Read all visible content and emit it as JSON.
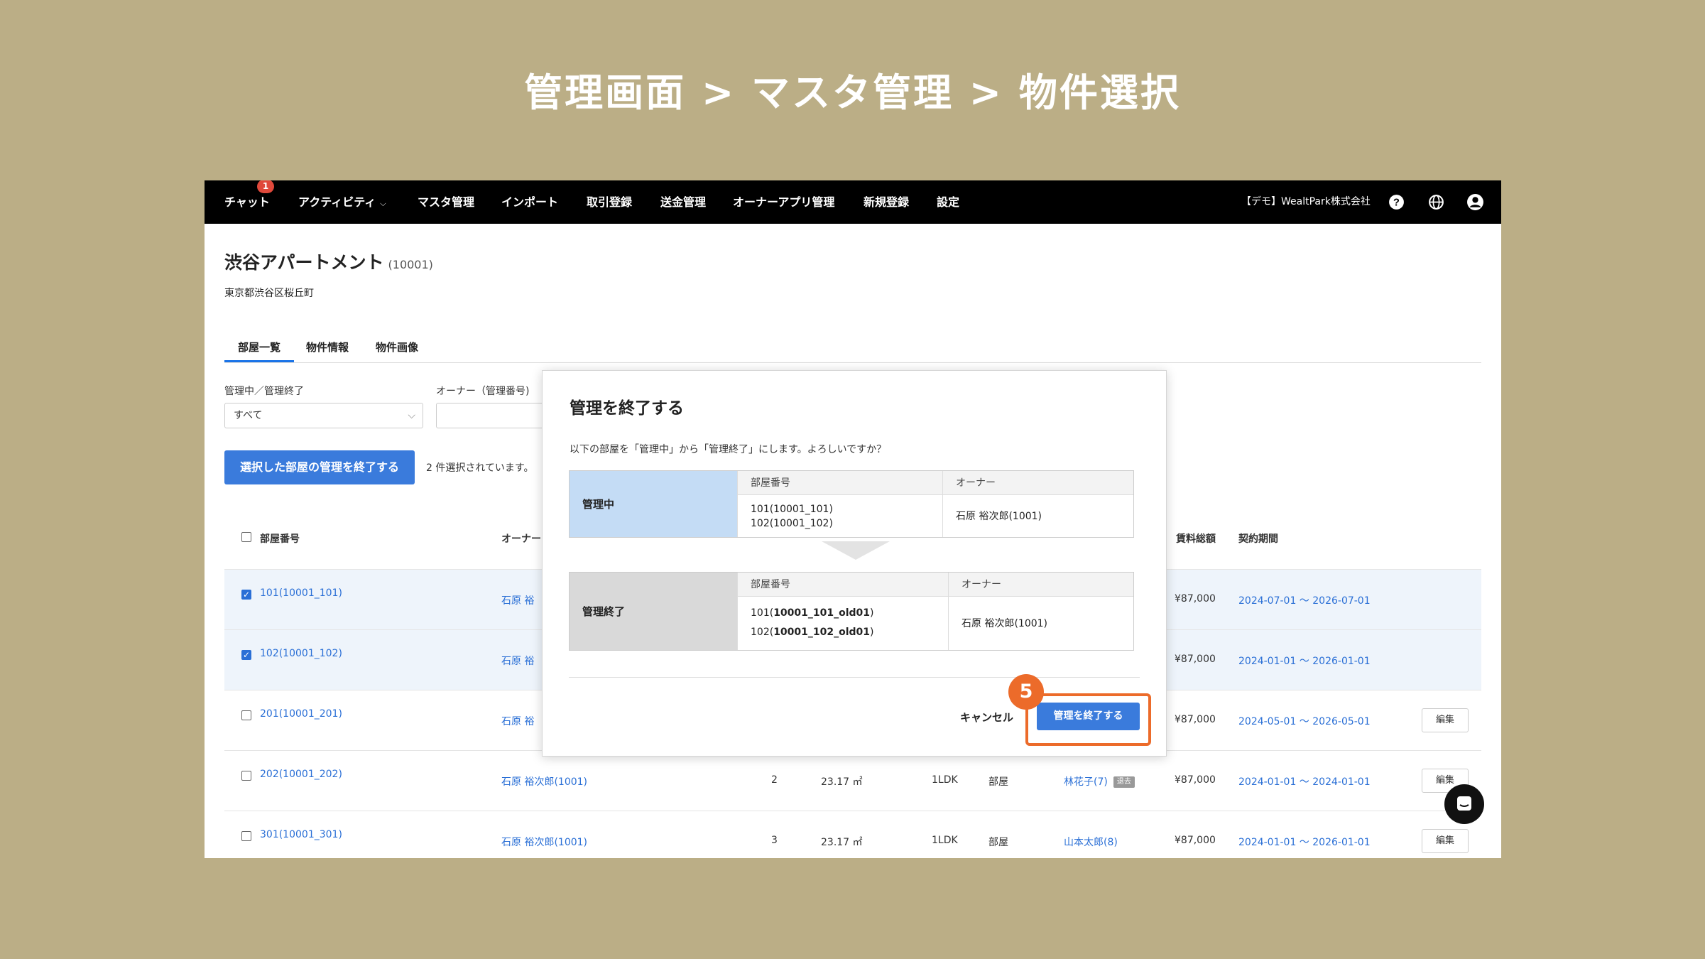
{
  "slide_title": "管理画面 > マスタ管理 > 物件選択",
  "nav": {
    "items": [
      {
        "label": "チャット",
        "badge": "1"
      },
      {
        "label": "アクティビティ"
      },
      {
        "label": "マスタ管理"
      },
      {
        "label": "インポート"
      },
      {
        "label": "取引登録"
      },
      {
        "label": "送金管理"
      },
      {
        "label": "オーナーアプリ管理"
      },
      {
        "label": "新規登録"
      },
      {
        "label": "設定"
      }
    ],
    "company": "【デモ】WealtPark株式会社",
    "icons": [
      "help-icon",
      "globe-icon",
      "user-account-icon"
    ]
  },
  "property": {
    "name": "渋谷アパートメント",
    "code": "(10001)",
    "address": "東京都渋谷区桜丘町"
  },
  "tabs": [
    "部屋一覧",
    "物件情報",
    "物件画像"
  ],
  "filters": {
    "status_label": "管理中／管理終了",
    "status_value": "すべて",
    "owner_label": "オーナー（管理番号)"
  },
  "bulk": {
    "end_button": "選択した部屋の管理を終了する",
    "selected_text": "2 件選択されています。"
  },
  "table": {
    "headers": {
      "room": "部屋番号",
      "owner": "オーナー",
      "rent_total": "賃料総額",
      "contract": "契約期間"
    },
    "rows": [
      {
        "checked": true,
        "room": "101(10001_101)",
        "owner": "石原 裕",
        "rent": "¥87,000",
        "period": "2024-07-01 〜 2026-07-01"
      },
      {
        "checked": true,
        "room": "102(10001_102)",
        "owner": "石原 裕",
        "rent": "¥87,000",
        "period": "2024-01-01 〜 2026-01-01"
      },
      {
        "checked": false,
        "room": "201(10001_201)",
        "owner": "石原 裕",
        "rent": "¥87,000",
        "period": "2024-05-01 〜 2026-05-01",
        "edit": "編集"
      },
      {
        "checked": false,
        "room": "202(10001_202)",
        "owner": "石原 裕次郎(1001)",
        "floor": "2",
        "area": "23.17 ㎡",
        "layout": "1LDK",
        "type": "部屋",
        "tenant": "林花子(7)",
        "tenant_tag": "退去",
        "rent": "¥87,000",
        "period": "2024-01-01 〜 2024-01-01",
        "edit": "編集"
      },
      {
        "checked": false,
        "room": "301(10001_301)",
        "owner": "石原 裕次郎(1001)",
        "floor": "3",
        "area": "23.17 ㎡",
        "layout": "1LDK",
        "type": "部屋",
        "tenant": "山本太郎(8)",
        "rent": "¥87,000",
        "period": "2024-01-01 〜 2026-01-01",
        "edit": "編集"
      }
    ]
  },
  "modal": {
    "title": "管理を終了する",
    "description": "以下の部屋を「管理中」から「管理終了」にします。よろしいですか？",
    "before": {
      "label": "管理中",
      "room_header": "部屋番号",
      "owner_header": "オーナー",
      "rooms": [
        "101(10001_101)",
        "102(10001_102)"
      ],
      "owner": "石原 裕次郎(1001)"
    },
    "after": {
      "label": "管理終了",
      "room_header": "部屋番号",
      "owner_header": "オーナー",
      "rooms": [
        {
          "prefix": "101(",
          "bold": "10001_101_old01",
          "suffix": ")"
        },
        {
          "prefix": "102(",
          "bold": "10001_102_old01",
          "suffix": ")"
        }
      ],
      "owner": "石原 裕次郎(1001)"
    },
    "cancel": "キャンセル",
    "confirm": "管理を終了する"
  },
  "annotation": {
    "step": "5",
    "color": "#ec6b2a"
  },
  "colors": {
    "background": "#bbae86",
    "primary": "#3a7bdc",
    "link": "#2a6fd6",
    "before_label_bg": "#c4dcf5",
    "after_label_bg": "#d9d9d9"
  }
}
